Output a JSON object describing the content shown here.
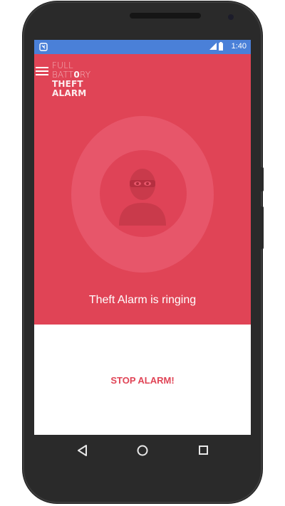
{
  "status_bar": {
    "time": "1:40",
    "bg_color": "#4a80d8",
    "icons": [
      "alarm-status-icon",
      "signal-icon",
      "battery-icon"
    ]
  },
  "app": {
    "logo": {
      "line1": "FULL",
      "line2": "BATT",
      "line2_mid": "0",
      "line2_end": "RY",
      "line3": "THEFT",
      "line4": "ALARM"
    },
    "menu_icon": "hamburger-menu-icon",
    "status_message": "Theft Alarm is ringing",
    "stop_button_label": "STOP ALARM!",
    "accent_color": "#e04456",
    "illustration_icon": "thief-icon"
  },
  "nav_bar": {
    "icons": [
      "back-icon",
      "home-icon",
      "recents-icon"
    ]
  }
}
